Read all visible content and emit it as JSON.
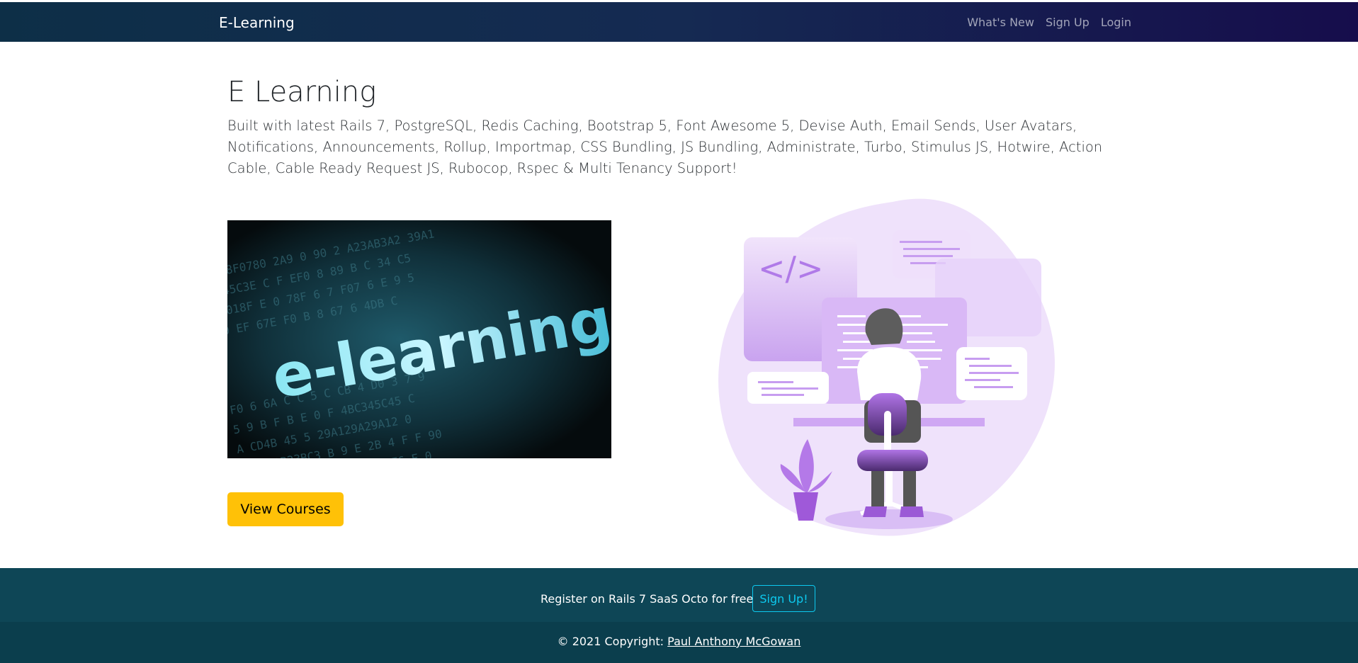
{
  "navbar": {
    "brand": "E-Learning",
    "links": [
      "What's New",
      "Sign Up",
      "Login"
    ]
  },
  "hero": {
    "title": "E Learning",
    "lead": "Built with latest Rails 7, PostgreSQL, Redis Caching, Bootstrap 5, Font Awesome 5, Devise Auth, Email Sends, User Avatars, Notifications, Announcements, Rollup, Importmap, CSS Bundling, JS Bundling, Administrate, Turbo, Stimulus JS, Hotwire, Action Cable, Cable Ready Request JS, Rubocop, Rspec & Multi Tenancy Support!",
    "image_text": "e-learning",
    "illustration_code_symbol": "</>",
    "cta_label": "View Courses"
  },
  "footer": {
    "register_text": "Register on Rails 7 SaaS Octo for free",
    "signup_label": "Sign Up!",
    "copyright_prefix": "© 2021 Copyright: ",
    "author": "Paul Anthony McGowan"
  },
  "colors": {
    "navbar_start": "#0d2f47",
    "navbar_end": "#160d4c",
    "cta": "#ffc107",
    "footer_signup": "#0e4656",
    "footer_copy": "#0b3e4d",
    "signup_outline": "#0dcaf0",
    "illustration_purple": "#b78ce8"
  }
}
